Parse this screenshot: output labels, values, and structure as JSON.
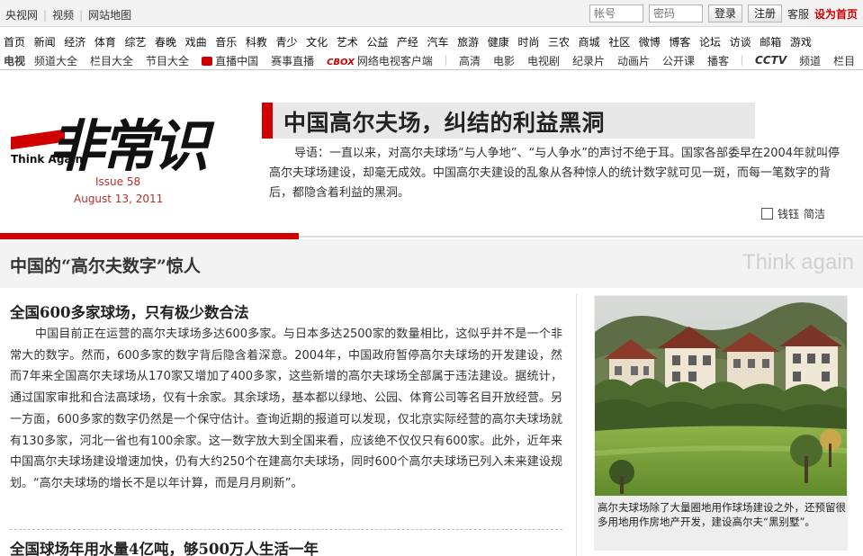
{
  "topbar": {
    "links": [
      "央视网",
      "视频",
      "网站地图"
    ],
    "username_placeholder": "帐号",
    "password_placeholder": "密码",
    "login_label": "登录",
    "register_label": "注册",
    "service_label": "客服",
    "set_home_label": "设为首页"
  },
  "nav": {
    "row1": [
      "首页",
      "新闻",
      "经济",
      "体育",
      "综艺",
      "春晚",
      "戏曲",
      "音乐",
      "科教",
      "青少",
      "文化",
      "艺术",
      "公益",
      "产经",
      "汽车",
      "旅游",
      "健康",
      "时尚",
      "三农",
      "商城",
      "社区",
      "微博",
      "博客",
      "论坛",
      "访谈",
      "邮箱",
      "游戏"
    ],
    "row2": {
      "tv_label": "电视",
      "group1": [
        "频道大全",
        "栏目大全",
        "节目大全"
      ],
      "live_label": "直播中国",
      "event_label": "赛事直播",
      "box_logo": "CBOX",
      "client_label": "网络电视客户端",
      "group2": [
        "高清",
        "电影",
        "电视剧",
        "纪录片",
        "动画片",
        "公开课",
        "播客"
      ],
      "cctv_logo": "CCTV",
      "group3": [
        "频道",
        "栏目"
      ]
    }
  },
  "masthead": {
    "logo_text": "非常识",
    "logo_subtitle": "Think Again",
    "issue": "Issue 58",
    "date": "August 13, 2011",
    "headline": "中国高尔夫场，纠结的利益黑洞",
    "lead": "导语：一直以来，对高尔夫球场“与人争地”、“与人争水”的声讨不绝于耳。国家各部委早在2004年就叫停高尔夫球场建设，却毫无成效。中国高尔夫建设的乱象从各种惊人的统计数字就可见一斑，而每一笔数字的背后，都隐含着利益的黑洞。",
    "tools": {
      "chk_label": "钱钰",
      "simplified_label": "简洁"
    }
  },
  "section": {
    "title": "中国的“高尔夫数字”惊人",
    "tagline": "Think again"
  },
  "article": {
    "heading1": "全国600多家球场，只有极少数合法",
    "paragraph1": "中国目前正在运营的高尔夫球场多达600多家。与日本多达2500家的数量相比，这似乎并不是一个非常大的数字。然而，600多家的数字背后隐含着深意。2004年，中国政府暂停高尔夫球场的开发建设，然而7年来全国高尔夫球场从170家又增加了400多家，这些新增的高尔夫球场全部属于违法建设。据统计，通过国家审批和合法高球场，仅有十余家。其余球场，基本都以绿地、公园、体育公司等名目开放经营。另一方面，600多家的数字仍然是一个保守估计。查询近期的报道可以发现，仅北京实际经营的高尔夫球场就有130多家，河北一省也有100余家。这一数字放大到全国来看，应该绝不仅仅只有600家。此外，近年来中国高尔夫球场建设增速加快，仍有大约250个在建高尔夫球场，同时600个高尔夫球场已列入未来建设规划。“高尔夫球场的增长不是以年计算，而是月月刷新”。",
    "heading2": "全国球场年用水量4亿吨，够500万人生活一年"
  },
  "photo": {
    "caption": "高尔夫球场除了大量圈地用作球场建设之外，还预留很多用地用作房地产开发，建设高尔夫“黑别墅”。"
  },
  "colors": {
    "accent_red": "#d10000",
    "date_red": "#b03030",
    "tagline_grey": "#d0d0d0"
  }
}
